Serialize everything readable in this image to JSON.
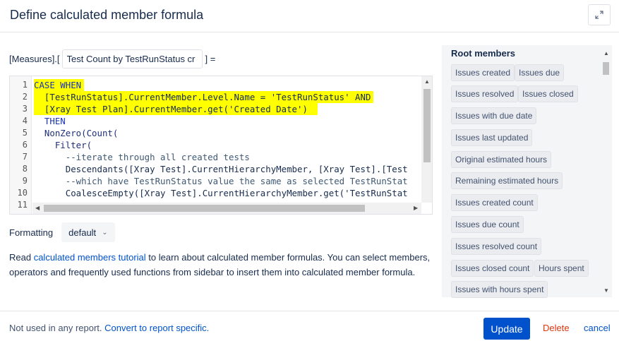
{
  "dialog": {
    "title": "Define calculated member formula"
  },
  "measure": {
    "prefix": "[Measures].[",
    "name_value": "Test Count by TestRunStatus cr",
    "suffix": "] ="
  },
  "editor": {
    "line_numbers": [
      "1",
      "2",
      "3",
      "4",
      "5",
      "6",
      "7",
      "8",
      "9",
      "10",
      "11"
    ],
    "lines": [
      "CASE WHEN",
      "  [TestRunStatus].CurrentMember.Level.Name = 'TestRunStatus' AND",
      "  [Xray Test Plan].CurrentMember.get('Created Date')",
      "  THEN",
      "  NonZero(Count(",
      "    Filter(",
      "      --iterate through all created tests",
      "      Descendants([Xray Test].CurrentHierarchyMember, [Xray Test].[Test",
      "      --which have TestRunStatus value the same as selected TestRunStat",
      "      CoalesceEmpty([Xray Test].CurrentHierarchyMember.get('TestRunStat",
      "      ...              ..."
    ]
  },
  "formatting": {
    "label": "Formatting",
    "selected": "default"
  },
  "help": {
    "prefix": "Read ",
    "link": "calculated members tutorial",
    "suffix": " to learn about calculated member formulas. You can select members, operators and frequently used functions from sidebar to insert them into calculated member formula."
  },
  "sidebar": {
    "title": "Root members",
    "items": [
      "Issues created",
      "Issues due",
      "Issues resolved",
      "Issues closed",
      "Issues with due date",
      "Issues last updated",
      "Original estimated hours",
      "Remaining estimated hours",
      "Issues created count",
      "Issues due count",
      "Issues resolved count",
      "Issues closed count",
      "Hours spent",
      "Issues with hours spent"
    ]
  },
  "footer": {
    "status_text": "Not used in any report.",
    "convert_link": "Convert to report specific.",
    "update_label": "Update",
    "delete_label": "Delete",
    "cancel_label": "cancel"
  },
  "colors": {
    "primary": "#0052cc",
    "danger": "#de350b",
    "highlight": "#ffff00"
  },
  "icons": {
    "expand": "expand-arrows-icon",
    "dropdown": "chevron-down-icon"
  }
}
